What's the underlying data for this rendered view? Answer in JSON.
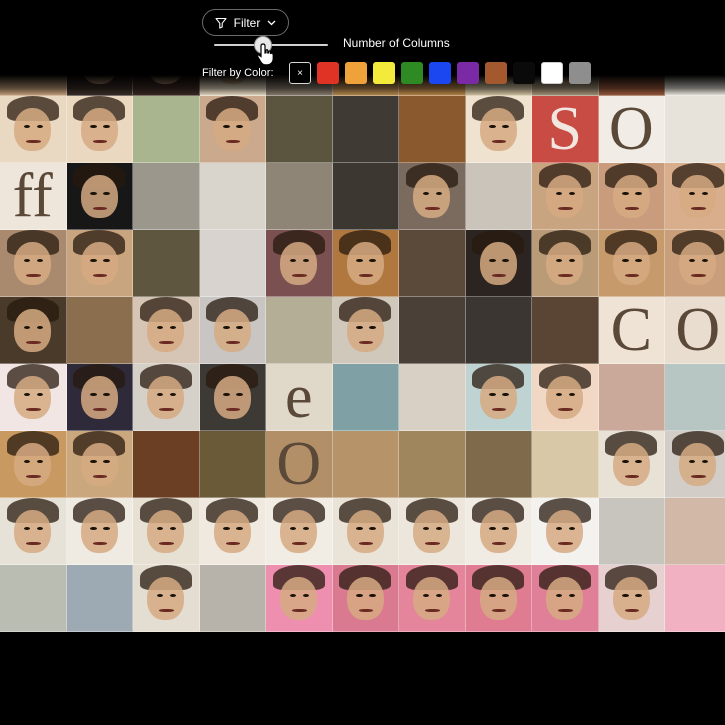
{
  "toolbar": {
    "filter_label": "Filter",
    "filter_icon": "funnel-icon",
    "dropdown_icon": "chevron-down-icon",
    "columns_label": "Number of Columns",
    "columns_slider_value": 0.42,
    "color_filter_label": "Filter by Color:",
    "clear_symbol": "×",
    "colors": [
      {
        "name": "red",
        "hex": "#e03325"
      },
      {
        "name": "orange",
        "hex": "#f0a23a"
      },
      {
        "name": "yellow",
        "hex": "#f4ea3b"
      },
      {
        "name": "green",
        "hex": "#2e8a23"
      },
      {
        "name": "blue",
        "hex": "#1b47f0"
      },
      {
        "name": "purple",
        "hex": "#7a2aa4"
      },
      {
        "name": "brown",
        "hex": "#a4582e"
      },
      {
        "name": "black",
        "hex": "#0a0a0a"
      },
      {
        "name": "white",
        "hex": "#ffffff"
      },
      {
        "name": "gray",
        "hex": "#8e8e8e"
      }
    ]
  },
  "grid": {
    "tiles": [
      [
        "#8a6f52",
        "#b08b63",
        "#6e5a45",
        "#d8ccb4",
        "#d0bf9e",
        "#7a3f3a",
        "#c9b486",
        "#b7a98e",
        "#dfe7e2",
        "#4c6a5a",
        "#d7d8d2"
      ],
      [
        "#c9a27c",
        "#3a2d27",
        "#3b2a23",
        "#e9dcc3",
        "#8a7d6f",
        "#b98a4f",
        "#b9854a",
        "#d6c6a3",
        "#a69579",
        "#9a5b3d",
        "#f0ece2"
      ],
      [
        "#e9d9c3",
        "#ead8c0",
        "#a8b58f",
        "#caa98c",
        "#5b5540",
        "#3f3a33",
        "#8a5a2e",
        "#efe2cf",
        "#c84c44",
        "#f1ede6",
        "#e7e2da"
      ],
      [
        "#efe6db",
        "#171717",
        "#9b978d",
        "#d9d5cc",
        "#8f8577",
        "#3c3731",
        "#7a6b5e",
        "#cac4bb",
        "#c9a480",
        "#c89c7c",
        "#d9ae8c"
      ],
      [
        "#a98a6e",
        "#c8a47f",
        "#5f563f",
        "#d8d3ce",
        "#7a5050",
        "#b0783f",
        "#5b4a3a",
        "#2c2420",
        "#b99b78",
        "#c79a6c",
        "#c99e7a"
      ],
      [
        "#4a3a2a",
        "#8a6e4d",
        "#d6c5b5",
        "#c8c5c2",
        "#b5ae97",
        "#d1c8bc",
        "#4b4038",
        "#3b3631",
        "#5a4535",
        "#eee3d5",
        "#e9ddcf"
      ],
      [
        "#f1e6e3",
        "#2f2a3a",
        "#d5d0c8",
        "#3d3a36",
        "#e0d8c8",
        "#7fa1a5",
        "#d8d0c4",
        "#bfd4d2",
        "#f0d8c5",
        "#caa99b",
        "#b7c5c3"
      ],
      [
        "#c89a62",
        "#caa77c",
        "#6b3f23",
        "#6a5a38",
        "#b28f67",
        "#b69369",
        "#9f865c",
        "#7f6a4c",
        "#d8c8a7",
        "#e7e1d6",
        "#d2cdc6"
      ],
      [
        "#e7e2d7",
        "#f0ebe2",
        "#e7e1d4",
        "#efe9df",
        "#f1ece4",
        "#e9e3d8",
        "#ece6dc",
        "#f0ebe3",
        "#f3f2ef",
        "#c8c5bf",
        "#d2b9a7"
      ],
      [
        "#b9bdb2",
        "#9eaab3",
        "#e3ddd2",
        "#b8b3aa",
        "#ee8fb0",
        "#d97a90",
        "#e4859b",
        "#df7c92",
        "#e08098",
        "#e6d1d0",
        "#f2b0c3"
      ]
    ]
  }
}
